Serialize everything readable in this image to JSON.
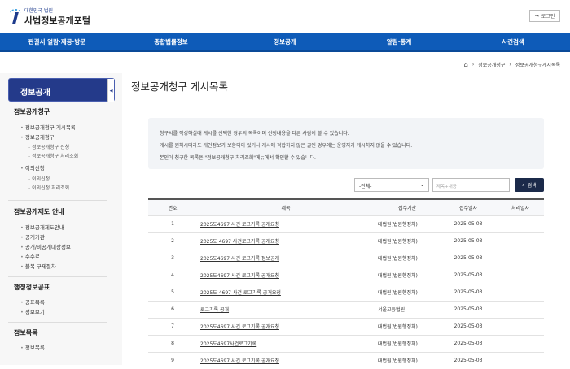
{
  "header": {
    "logo_sub": "대한민국 법원",
    "logo_main": "사법정보공개포털",
    "login": "로그인"
  },
  "nav": [
    "판결서 열람·제공·방문",
    "종합법률정보",
    "정보공개",
    "알림·통계",
    "사건검색"
  ],
  "breadcrumb": [
    "정보공개청구",
    "정보공개청구게시목록"
  ],
  "sidebar": {
    "title": "정보공개",
    "sections": [
      {
        "title": "정보공개청구",
        "items": [
          "정보공개청구 게시목록",
          "정보공개청구",
          "이의신청"
        ],
        "subs": [
          "정보공개청구 신청",
          "정보공개청구 처리조회",
          "이의신청",
          "이의신청 처리조회"
        ]
      },
      {
        "title": "정보공개제도 안내",
        "items": [
          "정보공개제도안내",
          "공개기관",
          "공개/비공개대상정보",
          "수수료",
          "불복 구제절차"
        ]
      },
      {
        "title": "행정정보공표",
        "items": [
          "공표목록",
          "정보보기"
        ]
      },
      {
        "title": "정보목록",
        "items": [
          "정보목록"
        ]
      }
    ]
  },
  "page": {
    "title": "정보공개청구 게시목록",
    "info": [
      "청구서를 작성하실때 게시를 선택한 경우의 목록이며 신청내용을 다른 사람이 볼 수 있습니다.",
      "게시를 원하시더라도 개인정보가 보함되어 있거나 게시에 적합하지 않은 글인 경우에는 운영자가 게시하지 않을 수 있습니다.",
      "본인이 청구한 목록은 \"정보공개청구 처리조회\"메뉴에서 확인할 수 있습니다."
    ]
  },
  "search": {
    "select": "-전체-",
    "placeholder": "제목+내용",
    "button": "검색"
  },
  "table": {
    "headers": [
      "번호",
      "제목",
      "접수기관",
      "접수일자",
      "처리일자"
    ],
    "rows": [
      [
        "1",
        "2025도4697 사건 로그기록 공개요청",
        "대법원(법원행정처)",
        "2025-05-03",
        ""
      ],
      [
        "2",
        "2025도 4697 사건로그기록 공개요청",
        "대법원(법원행정처)",
        "2025-05-03",
        ""
      ],
      [
        "3",
        "2025도4697 사건 로그기록 정보공개",
        "대법원(법원행정처)",
        "2025-05-03",
        ""
      ],
      [
        "4",
        "2025도4697 사건 로그기록 공개요청",
        "대법원(법원행정처)",
        "2025-05-03",
        ""
      ],
      [
        "5",
        "2025도 4697 사건 로그기록 공개요청",
        "대법원(법원행정처)",
        "2025-05-03",
        ""
      ],
      [
        "6",
        "로그기록 공개",
        "서울고등법원",
        "2025-05-03",
        ""
      ],
      [
        "7",
        "2025도4697 사건 로그기록 공개요청",
        "대법원(법원행정처)",
        "2025-05-03",
        ""
      ],
      [
        "8",
        "2025도4697사건로그기록",
        "대법원(법원행정처)",
        "2025-05-03",
        ""
      ],
      [
        "9",
        "2025도4697 사건 로그기록 공개요청",
        "대법원(법원행정처)",
        "2025-05-03",
        ""
      ]
    ]
  }
}
